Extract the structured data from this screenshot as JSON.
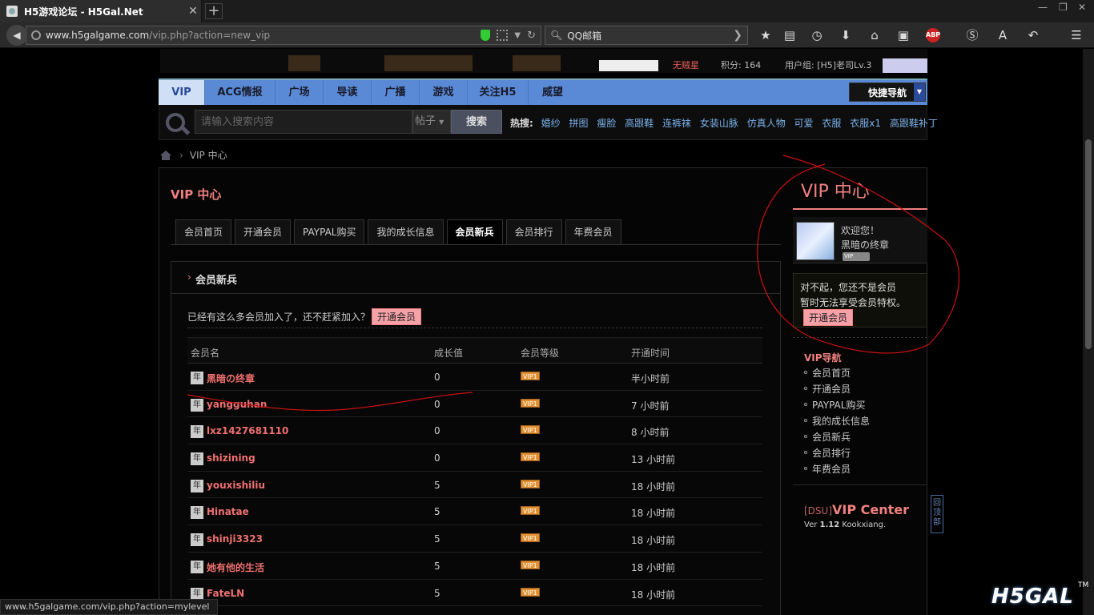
{
  "browser": {
    "tab_title": "H5游戏论坛 - H5Gal.Net",
    "tab_close": "✕",
    "new_tab": "+",
    "url_domain": "www.h5galgame.com",
    "url_path": "/vip.php?action=new_vip",
    "search_value": "QQ邮箱",
    "status_url": "www.h5galgame.com/vip.php?action=mylevel",
    "win_min": "—",
    "win_max": "❐",
    "win_close": "✕"
  },
  "banner": {
    "status_1": "无贼星",
    "status_2": "积分: 164",
    "status_3": "用户组: [H5]老司Lv.3"
  },
  "nav": {
    "items": [
      {
        "label": "VIP"
      },
      {
        "label": "ACG情报"
      },
      {
        "label": "广场"
      },
      {
        "label": "导读"
      },
      {
        "label": "广播"
      },
      {
        "label": "游戏"
      },
      {
        "label": "关注H5"
      },
      {
        "label": "威望"
      }
    ],
    "quick_nav": "快捷导航"
  },
  "search": {
    "placeholder": "请输入搜索内容",
    "type": "帖子",
    "button": "搜索",
    "hot_label": "热搜:",
    "hot_words": [
      "婚纱",
      "拼图",
      "瘦脸",
      "高跟鞋",
      "连裤袜",
      "女装山脉",
      "仿真人物",
      "可爱",
      "衣服",
      "衣服x1",
      "高跟鞋补丁"
    ]
  },
  "breadcrumb": {
    "sep": "›",
    "current": "VIP 中心"
  },
  "main": {
    "title": "VIP 中心",
    "tabs": [
      {
        "label": "会员首页"
      },
      {
        "label": "开通会员"
      },
      {
        "label": "PAYPAL购买"
      },
      {
        "label": "我的成长信息"
      },
      {
        "label": "会员新兵"
      },
      {
        "label": "会员排行"
      },
      {
        "label": "年费会员"
      }
    ],
    "panel_title": "会员新兵",
    "invite_text": "已经有这么多会员加入了，还不赶紧加入？",
    "invite_button": "开通会员",
    "columns": [
      "会员名",
      "成长值",
      "会员等级",
      "开通时间"
    ],
    "year_badge": "年",
    "vip_level": "VIP1",
    "rows": [
      {
        "name": "黑暗の终章",
        "growth": "0",
        "time": "半小时前"
      },
      {
        "name": "yangguhan",
        "growth": "0",
        "time": "7 小时前"
      },
      {
        "name": "lxz1427681110",
        "growth": "0",
        "time": "8 小时前"
      },
      {
        "name": "shizining",
        "growth": "0",
        "time": "13 小时前"
      },
      {
        "name": "youxishiliu",
        "growth": "5",
        "time": "18 小时前"
      },
      {
        "name": "Hinatae",
        "growth": "5",
        "time": "18 小时前"
      },
      {
        "name": "shinji3323",
        "growth": "5",
        "time": "18 小时前"
      },
      {
        "name": "她有他的生活",
        "growth": "5",
        "time": "18 小时前"
      },
      {
        "name": "FateLN",
        "growth": "5",
        "time": "18 小时前"
      }
    ]
  },
  "sidebar": {
    "title": "VIP 中心",
    "welcome": "欢迎您！",
    "username": "黑暗の终章",
    "vip_tag": "VIP",
    "notice_1": "对不起，您还不是会员",
    "notice_2": "暂时无法享受会员特权。",
    "open_button": "开通会员",
    "nav_title": "VIP导航",
    "nav_items": [
      "会员首页",
      "开通会员",
      "PAYPAL购买",
      "我的成长信息",
      "会员新兵",
      "会员排行",
      "年费会员"
    ],
    "dsu": "[DSU]",
    "vip_center": "VIP Center",
    "ver_prefix": "Ver ",
    "ver_num": "1.12",
    "ver_author": " Kookxiang.",
    "back_top": "回顶部"
  },
  "watermark": {
    "logo": "H5GAL",
    "tm": "TM"
  },
  "colors": {
    "accent": "#f08080",
    "nav_blue": "#5a8ad6",
    "annotation_red": "#cc1111"
  }
}
